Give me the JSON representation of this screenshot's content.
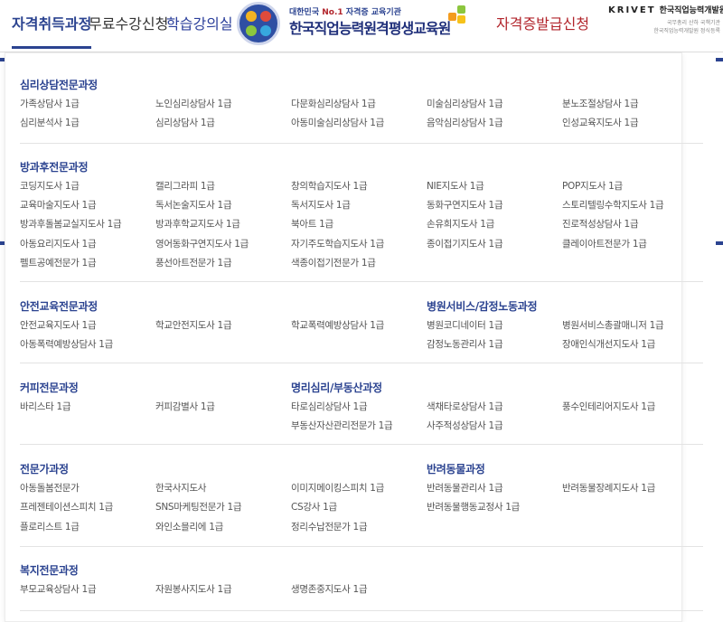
{
  "header": {
    "nav": {
      "certification": "자격취득과정",
      "free_course": "무료수강신청",
      "learning_room": "학습강의실",
      "cert_issue": "자격증발급신청"
    },
    "logo": {
      "tagline_prefix": "대한민국 ",
      "tagline_bold": "No.1",
      "tagline_suffix": " 자격증 교육기관",
      "name": "한국직업능력원격평생교육원"
    },
    "krivet": {
      "name": "KRIVET",
      "korean": "한국직업능력개발원",
      "line1": "국무총리 산하 국책기관",
      "line2": "한국직업능력개발원 정식등록"
    },
    "colors": {
      "primary": "#2b4390",
      "accent_red": "#b2252c"
    }
  },
  "sections": {
    "counsel": {
      "title": "심리상담전문과정",
      "items": [
        "가족상담사 1급",
        "노인심리상담사 1급",
        "다문화심리상담사 1급",
        "미술심리상담사 1급",
        "분노조절상담사 1급",
        "심리분석사 1급",
        "심리상담사 1급",
        "아동미술심리상담사 1급",
        "음악심리상담사 1급",
        "인성교육지도사 1급"
      ]
    },
    "afterschool": {
      "title": "방과후전문과정",
      "items": [
        "코딩지도사 1급",
        "캘리그라피 1급",
        "창의학습지도사 1급",
        "NIE지도사 1급",
        "POP지도사 1급",
        "교육마술지도사 1급",
        "독서논술지도사 1급",
        "독서지도사 1급",
        "동화구연지도사 1급",
        "스토리텔링수학지도사 1급",
        "방과후돌봄교실지도사 1급",
        "방과후학교지도사 1급",
        "북아트 1급",
        "손유희지도사 1급",
        "진로적성상담사 1급",
        "아동요리지도사 1급",
        "영어동화구연지도사 1급",
        "자기주도학습지도사 1급",
        "종이접기지도사 1급",
        "클레이아트전문가 1급",
        "펠트공예전문가 1급",
        "풍선아트전문가 1급",
        "색종이접기전문가 1급"
      ]
    },
    "safety": {
      "title": "안전교육전문과정",
      "items": [
        "안전교육지도사 1급",
        "학교안전지도사 1급",
        "학교폭력예방상담사 1급",
        "아동폭력예방상담사 1급"
      ]
    },
    "hospital": {
      "title": "병원서비스/감정노동과정",
      "items": [
        "병원코디네이터 1급",
        "병원서비스총괄매니저 1급",
        "감정노동관리사 1급",
        "장애인식개선지도사 1급"
      ]
    },
    "coffee": {
      "title": "커피전문과정",
      "items": [
        "바리스타 1급",
        "커피감별사 1급"
      ]
    },
    "myeongri": {
      "title": "명리심리/부동산과정",
      "items": [
        "타로심리상담사 1급",
        "색채타로상담사 1급",
        "풍수인테리어지도사 1급",
        "부동산자산관리전문가 1급",
        "사주적성상담사 1급"
      ]
    },
    "expert": {
      "title": "전문가과정",
      "items": [
        "아동돌봄전문가",
        "한국사지도사",
        "이미지메이킹스피치 1급",
        "프레젠테이션스피치 1급",
        "SNS마케팅전문가 1급",
        "CS강사 1급",
        "플로리스트 1급",
        "와인소믈리에 1급",
        "정리수납전문가 1급"
      ]
    },
    "pet": {
      "title": "반려동물과정",
      "items": [
        "반려동물관리사 1급",
        "반려동물장례지도사 1급",
        "반려동물행동교정사 1급"
      ]
    },
    "welfare": {
      "title": "복지전문과정",
      "items": [
        "부모교육상담사 1급",
        "자원봉사지도사 1급",
        "생명존중지도사 1급"
      ]
    }
  }
}
